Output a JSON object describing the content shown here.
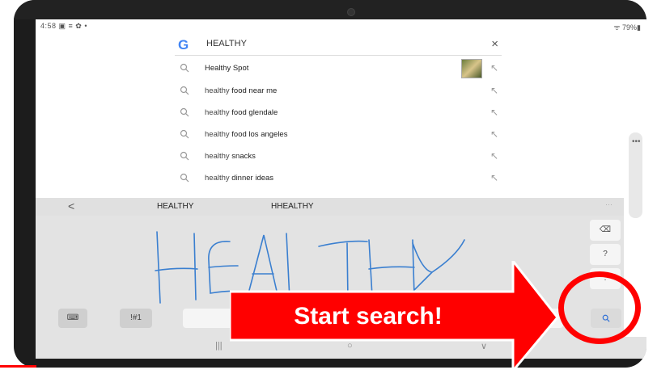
{
  "status_bar": {
    "time_and_icons": "4:58 ▣ ≡ ✿ •",
    "battery": "ᯤ 79%▮"
  },
  "search": {
    "logo": "G",
    "query": "HEALTHY",
    "clear_icon": "×"
  },
  "suggestions": [
    {
      "text_prefix": "Healthy Spot",
      "text_rest": "",
      "has_thumbnail": true
    },
    {
      "text_prefix": "healthy",
      "text_rest": " food near me"
    },
    {
      "text_prefix": "healthy",
      "text_rest": " food glendale"
    },
    {
      "text_prefix": "healthy",
      "text_rest": " food los angeles"
    },
    {
      "text_prefix": "healthy",
      "text_rest": " snacks"
    },
    {
      "text_prefix": "healthy",
      "text_rest": " dinner ideas"
    }
  ],
  "keyboard": {
    "candidate_back": "<",
    "candidates": [
      "HEALTHY",
      "HHEALTHY"
    ],
    "more": "···",
    "handwriting": "HEALTHY",
    "side_keys": {
      "backspace": "⌫",
      "question": "?",
      "dot": "."
    },
    "bottom": {
      "emoji_key": "⌨",
      "symbols_key": "!#1",
      "search_key": "🔍"
    }
  },
  "navbar": {
    "recent": "|||",
    "home": "○",
    "back": "∨"
  },
  "annotation": {
    "label": "Start search!",
    "color": "#ff0000"
  }
}
